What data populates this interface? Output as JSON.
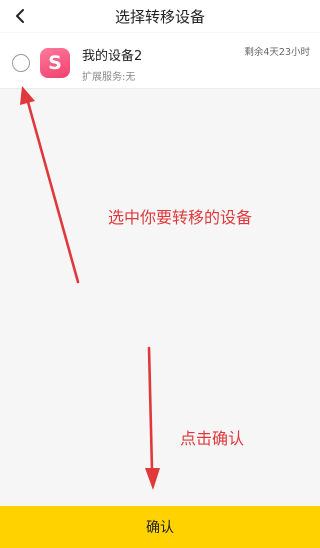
{
  "header": {
    "title": "选择转移设备",
    "back_icon": "chevron-left-icon"
  },
  "device": {
    "name": "我的设备2",
    "subtitle": "扩展服务:无",
    "remaining": "剩余4天23小时",
    "icon_letter": "S",
    "icon_color": "#f2406e",
    "selected": false
  },
  "annotations": {
    "select_hint": "选中你要转移的设备",
    "confirm_hint": "点击确认",
    "color": "#e0393c"
  },
  "footer": {
    "confirm_label": "确认",
    "button_color": "#ffd200"
  }
}
